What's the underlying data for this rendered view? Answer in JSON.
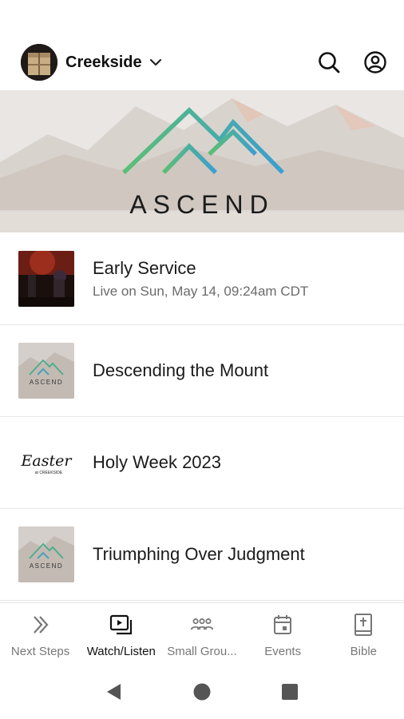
{
  "header": {
    "title": "Creekside",
    "avatar_icon": "church-building-icon",
    "search_icon": "search-icon",
    "account_icon": "account-icon"
  },
  "hero": {
    "title": "ASCEND",
    "colors": {
      "mountain_green": "#5bbf72",
      "mountain_blue": "#3a9fd0"
    }
  },
  "items": [
    {
      "title": "Early Service",
      "subtitle": "Live on Sun, May 14, 09:24am CDT"
    },
    {
      "title": "Descending the Mount",
      "thumb_text": "ASCEND"
    },
    {
      "title": "Holy Week 2023",
      "thumb_text": "Easter",
      "thumb_sub": "at CREEKSIDE"
    },
    {
      "title": "Triumphing Over Judgment",
      "thumb_text": "ASCEND"
    }
  ],
  "tabs": [
    {
      "label": "Next Steps",
      "icon": "double-chevron-icon",
      "active": false
    },
    {
      "label": "Watch/Listen",
      "icon": "play-stack-icon",
      "active": true
    },
    {
      "label": "Small Grou...",
      "icon": "group-icon",
      "active": false
    },
    {
      "label": "Events",
      "icon": "calendar-icon",
      "active": false
    },
    {
      "label": "Bible",
      "icon": "bible-icon",
      "active": false
    }
  ],
  "system_nav": {
    "back": "back-icon",
    "home": "home-icon",
    "recents": "recents-icon"
  }
}
